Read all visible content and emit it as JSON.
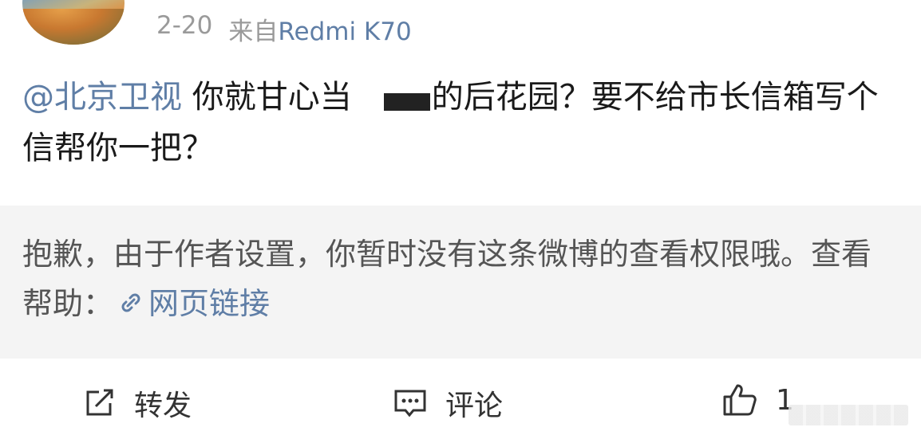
{
  "post": {
    "date": "2-20",
    "source_prefix": "来自",
    "device": "Redmi K70",
    "mention": "@北京卫视",
    "text_part1": " 你就甘心当",
    "text_part2": "的后花园？要不给市长信箱写个信帮你一把？"
  },
  "notice": {
    "text": "抱歉，由于作者设置，你暂时没有这条微博的查看权限哦。查看帮助：",
    "link_label": "网页链接"
  },
  "actions": {
    "share_label": "转发",
    "comment_label": "评论",
    "like_count": "1"
  },
  "icons": {
    "share": "share-icon",
    "comment": "comment-icon",
    "like": "thumbs-up-icon",
    "link": "link-icon"
  },
  "colors": {
    "link": "#5f7ea6",
    "meta": "#9a9a9a",
    "notice_bg": "#f4f4f4"
  }
}
